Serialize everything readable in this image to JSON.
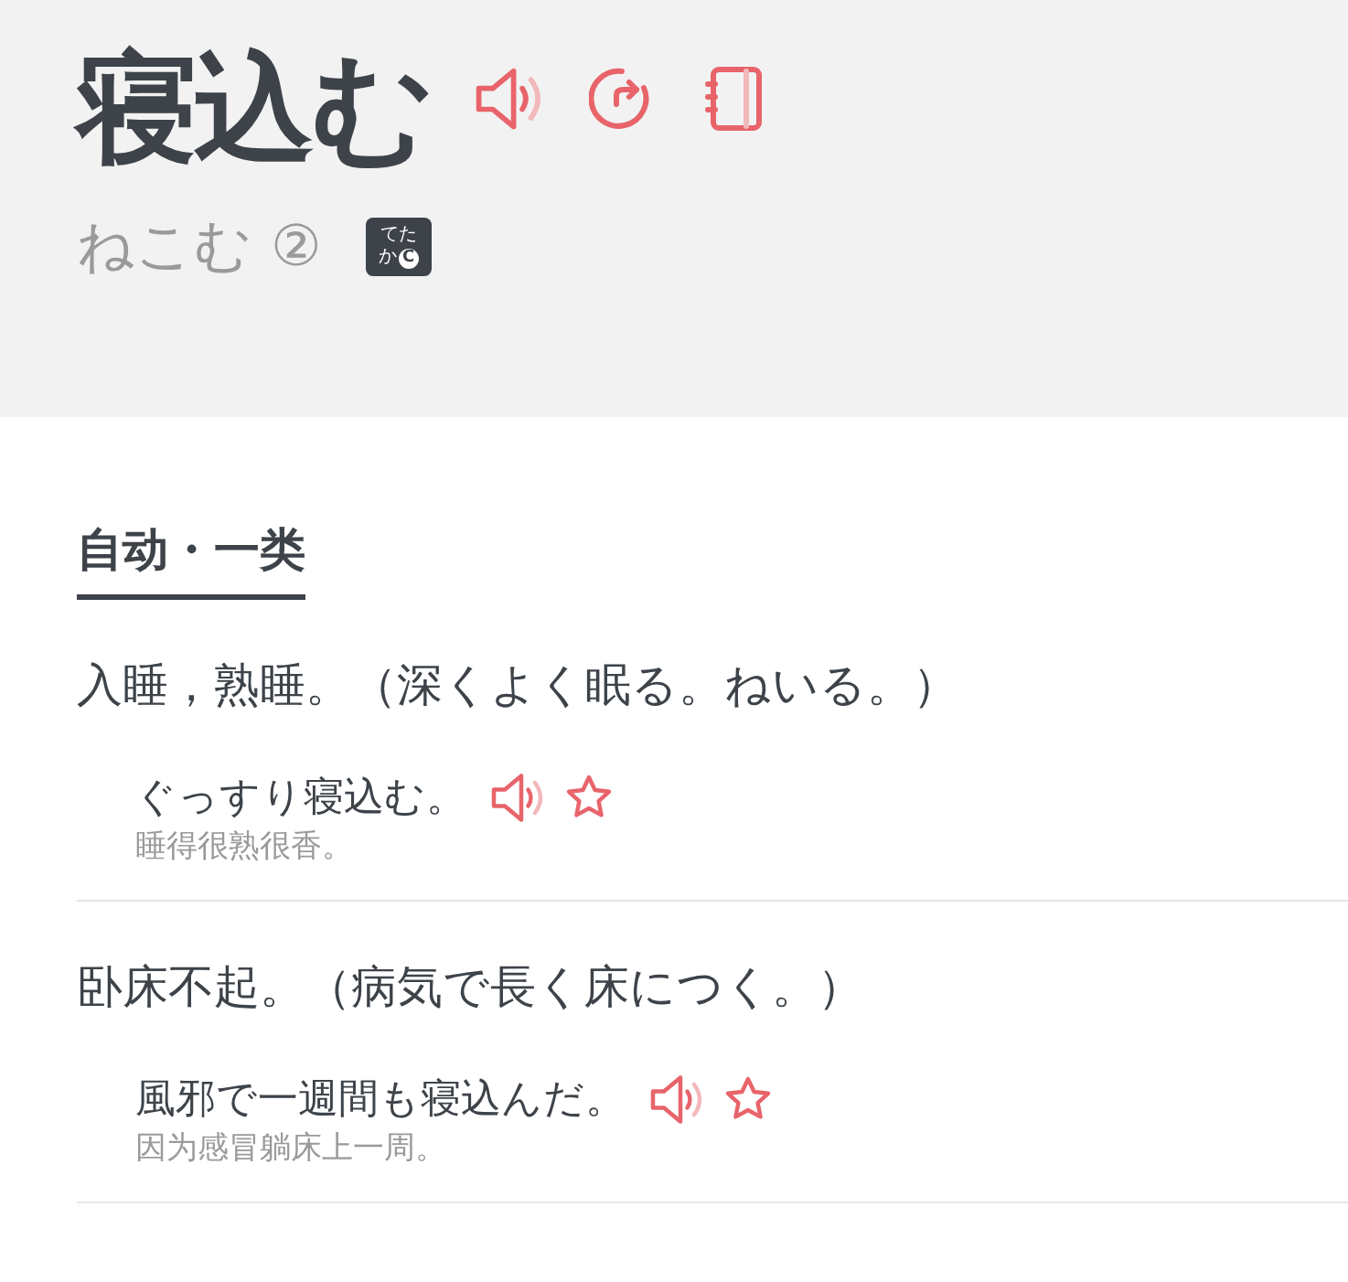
{
  "word": "寝込む",
  "reading": "ねこむ",
  "accent": "②",
  "badge": {
    "top": "てた",
    "bottom": "か",
    "mark": "C"
  },
  "pos": "自动・一类",
  "senses": [
    {
      "definition": "入睡，熟睡。（深くよく眠る。ねいる。）",
      "example": "ぐっすり寝込む。",
      "translation": "睡得很熟很香。",
      "starred": false
    },
    {
      "definition": "卧床不起。（病気で長く床につく。）",
      "example": "風邪で一週間も寝込んだ。",
      "translation": "因为感冒躺床上一周。",
      "starred": false
    }
  ]
}
